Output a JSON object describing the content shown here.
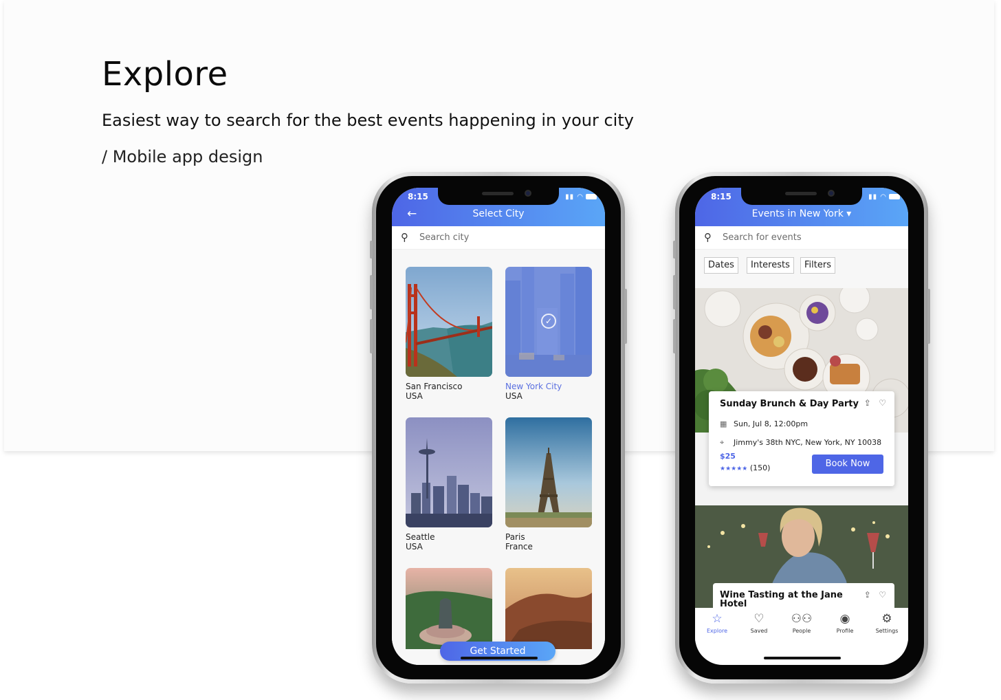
{
  "hero": {
    "title": "Explore",
    "subtitle": "Easiest way to search for the best events happening in your city",
    "tag": "/ Mobile app design"
  },
  "phone_left": {
    "status": {
      "time": "8:15"
    },
    "appbar": {
      "back_icon": "arrow-left-icon",
      "title": "Select City"
    },
    "search": {
      "placeholder": "Search city"
    },
    "cities": [
      {
        "name": "San Francisco",
        "country": "USA",
        "selected": false
      },
      {
        "name": "New York City",
        "country": "USA",
        "selected": true
      },
      {
        "name": "Seattle",
        "country": "USA",
        "selected": false
      },
      {
        "name": "Paris",
        "country": "France",
        "selected": false
      }
    ],
    "cta": "Get Started"
  },
  "phone_right": {
    "status": {
      "time": "8:15"
    },
    "appbar": {
      "title": "Events in New York ▾"
    },
    "search": {
      "placeholder": "Search for events"
    },
    "filters": [
      "Dates",
      "Interests",
      "Filters"
    ],
    "events": [
      {
        "title": "Sunday Brunch & Day Party",
        "date": "Sun, Jul 8, 12:00pm",
        "location": "Jimmy's 38th NYC, New York, NY 10038",
        "price": "$25",
        "stars": "★★★★★",
        "reviews": "(150)",
        "cta": "Book Now"
      },
      {
        "title": "Wine Tasting at the Jane Hotel"
      }
    ],
    "tabs": [
      {
        "label": "Explore",
        "icon": "star-icon",
        "active": true
      },
      {
        "label": "Saved",
        "icon": "heart-icon",
        "active": false
      },
      {
        "label": "People",
        "icon": "people-icon",
        "active": false
      },
      {
        "label": "Profile",
        "icon": "profile-icon",
        "active": false
      },
      {
        "label": "Settings",
        "icon": "gear-icon",
        "active": false
      }
    ]
  },
  "colors": {
    "accent": "#4e66e6",
    "accent_light": "#5aa6f7",
    "background": "#fcfcfc"
  }
}
